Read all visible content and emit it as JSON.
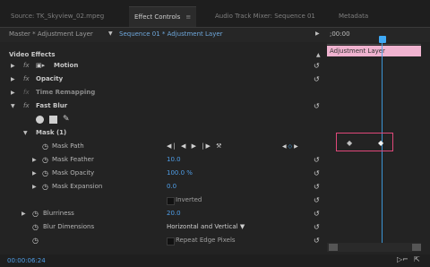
{
  "tabs": [
    {
      "label": "Source: TK_Skyview_02.mpeg",
      "active": false
    },
    {
      "label": "Effect Controls",
      "active": true
    },
    {
      "label": "Audio Track Mixer: Sequence 01",
      "active": false
    },
    {
      "label": "Metadata",
      "active": false
    }
  ],
  "tab_close": "≡",
  "header": {
    "master": "Master * Adjustment Layer",
    "sequence": "Sequence 01 * Adjustment Layer",
    "timecode": ";00:00"
  },
  "timeline": {
    "clip_label": "Adjustment Layer"
  },
  "effects": {
    "title": "Video Effects",
    "motion": "Motion",
    "opacity": "Opacity",
    "time_remapping": "Time Remapping",
    "fast_blur": "Fast Blur",
    "fx": "fx",
    "mask": "Mask (1)",
    "mask_path": "Mask Path",
    "mask_feather": {
      "label": "Mask Feather",
      "value": "10.0"
    },
    "mask_opacity": {
      "label": "Mask Opacity",
      "value": "100.0 %"
    },
    "mask_expansion": {
      "label": "Mask Expansion",
      "value": "0.0"
    },
    "inverted": "Inverted",
    "blurriness": {
      "label": "Blurriness",
      "value": "20.0"
    },
    "blur_dimensions": {
      "label": "Blur Dimensions",
      "value": "Horizontal and Vertical"
    },
    "repeat_edge": "Repeat Edge Pixels"
  },
  "footer": {
    "timecode": "00:00:06:24"
  }
}
